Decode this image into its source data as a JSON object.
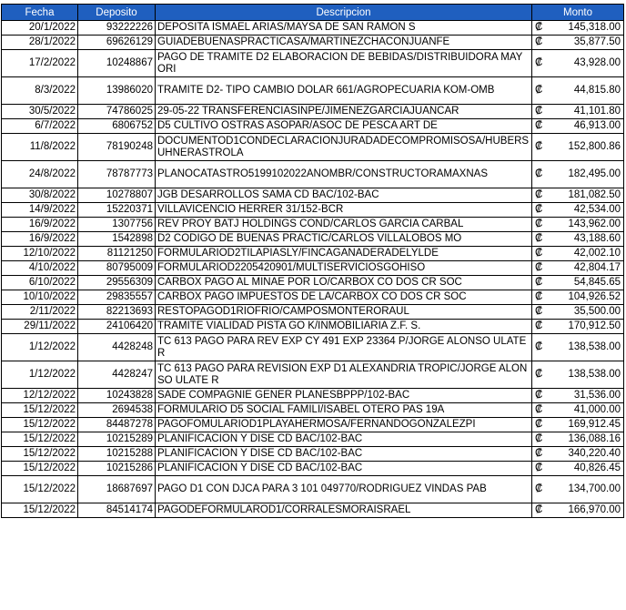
{
  "table": {
    "headers": [
      "Fecha",
      "Deposito",
      "Descripcion",
      "Monto"
    ],
    "currency_symbol": "₡",
    "header_bg": "#1f5fbf",
    "rows": [
      {
        "fecha": "20/1/2022",
        "deposito": "93222226",
        "descripcion": "DEPOSITA ISMAEL ARIAS/MAYSA DE SAN RAMON S",
        "monto": "145,318.00"
      },
      {
        "fecha": "28/1/2022",
        "deposito": "69626129",
        "descripcion": "GUIADEBUENASPRACTICASA/MARTINEZCHACONJUANFE",
        "monto": "35,877.50"
      },
      {
        "fecha": "17/2/2022",
        "deposito": "10248867",
        "descripcion": "PAGO DE TRAMITE D2 ELABORACION DE BEBIDAS/DISTRIBUIDORA MAYORI",
        "monto": "43,928.00"
      },
      {
        "fecha": "8/3/2022",
        "deposito": "13986020",
        "descripcion": "TRAMITE D2- TIPO CAMBIO DOLAR 661/AGROPECUARIA KOM-OMB",
        "monto": "44,815.80"
      },
      {
        "fecha": "30/5/2022",
        "deposito": "74786025",
        "descripcion": "29-05-22 TRANSFERENCIASINPE/JIMENEZGARCIAJUANCAR",
        "monto": "41,101.80"
      },
      {
        "fecha": "6/7/2022",
        "deposito": "6806752",
        "descripcion": "D5 CULTIVO OSTRAS ASOPAR/ASOC DE PESCA ART DE",
        "monto": "46,913.00"
      },
      {
        "fecha": "11/8/2022",
        "deposito": "78190248",
        "descripcion": "DOCUMENTOD1CONDECLARACIONJURADADECOMPROMISOSA/HUBERSUHNERASTROLA",
        "monto": "152,800.86"
      },
      {
        "fecha": "24/8/2022",
        "deposito": "78787773",
        "descripcion": "PLANOCATASTRO5199102022ANOMBR/CONSTRUCTORAMAXNAS",
        "monto": "182,495.00"
      },
      {
        "fecha": "30/8/2022",
        "deposito": "10278807",
        "descripcion": "JGB DESARROLLOS SAMA CD BAC/102-BAC",
        "monto": "181,082.50"
      },
      {
        "fecha": "14/9/2022",
        "deposito": "15220371",
        "descripcion": "VILLAVICENCIO HERRER 31/152-BCR",
        "monto": "42,534.00"
      },
      {
        "fecha": "16/9/2022",
        "deposito": "1307756",
        "descripcion": "REV PROY BATJ HOLDINGS COND/CARLOS GARCIA CARBAL",
        "monto": "143,962.00"
      },
      {
        "fecha": "16/9/2022",
        "deposito": "1542898",
        "descripcion": "D2 CODIGO DE BUENAS PRACTIC/CARLOS VILLALOBOS MO",
        "monto": "43,188.60"
      },
      {
        "fecha": "12/10/2022",
        "deposito": "81121250",
        "descripcion": "FORMULARIOD2TILAPIASLY/FINCAGANADERADELYLDE",
        "monto": "42,002.10"
      },
      {
        "fecha": "4/10/2022",
        "deposito": "80795009",
        "descripcion": "FORMULARIOD2205420901/MULTISERVICIOSGOHISO",
        "monto": "42,804.17"
      },
      {
        "fecha": "6/10/2022",
        "deposito": "29556309",
        "descripcion": "CARBOX PAGO AL MINAE POR LO/CARBOX CO DOS CR SOC",
        "monto": "54,845.65"
      },
      {
        "fecha": "10/10/2022",
        "deposito": "29835557",
        "descripcion": "CARBOX PAGO IMPUESTOS DE LA/CARBOX CO DOS CR SOC",
        "monto": "104,926.52"
      },
      {
        "fecha": "2/11/2022",
        "deposito": "82213693",
        "descripcion": "RESTOPAGOD1RIOFRIO/CAMPOSMONTERORAUL",
        "monto": "35,500.00"
      },
      {
        "fecha": "29/11/2022",
        "deposito": "24106420",
        "descripcion": "TRAMITE VIALIDAD PISTA GO K/INMOBILIARIA Z.F. S.",
        "monto": "170,912.50"
      },
      {
        "fecha": "1/12/2022",
        "deposito": "4428248",
        "descripcion": "TC 613 PAGO PARA REV EXP CY 491  EXP 23364 P/JORGE ALONSO ULATE R",
        "monto": "138,538.00"
      },
      {
        "fecha": "1/12/2022",
        "deposito": "4428247",
        "descripcion": "TC 613 PAGO PARA REVISION EXP D1 ALEXANDRIA TROPIC/JORGE ALONSO ULATE R",
        "monto": "138,538.00"
      },
      {
        "fecha": "12/12/2022",
        "deposito": "10243828",
        "descripcion": "SADE COMPAGNIE GENER PLANESBPPP/102-BAC",
        "monto": "31,536.00"
      },
      {
        "fecha": "15/12/2022",
        "deposito": "2694538",
        "descripcion": "FORMULARIO D5 SOCIAL FAMILI/ISABEL OTERO PAS 19A",
        "monto": "41,000.00"
      },
      {
        "fecha": "15/12/2022",
        "deposito": "84487278",
        "descripcion": "PAGOFOMULARIOD1PLAYAHERMOSA/FERNANDOGONZALEZPI",
        "monto": "169,912.45"
      },
      {
        "fecha": "15/12/2022",
        "deposito": "10215289",
        "descripcion": "PLANIFICACION Y DISE CD BAC/102-BAC",
        "monto": "136,088.16"
      },
      {
        "fecha": "15/12/2022",
        "deposito": "10215288",
        "descripcion": "PLANIFICACION Y DISE CD BAC/102-BAC",
        "monto": "340,220.40"
      },
      {
        "fecha": "15/12/2022",
        "deposito": "10215286",
        "descripcion": "PLANIFICACION Y DISE CD BAC/102-BAC",
        "monto": "40,826.45"
      },
      {
        "fecha": "15/12/2022",
        "deposito": "18687697",
        "descripcion": "PAGO D1 CON DJCA PARA 3 101 049770/RODRIGUEZ VINDAS PAB",
        "monto": "134,700.00"
      },
      {
        "fecha": "15/12/2022",
        "deposito": "84514174",
        "descripcion": "PAGODEFORMULAROD1/CORRALESMORAISRAEL",
        "monto": "166,970.00"
      }
    ]
  }
}
